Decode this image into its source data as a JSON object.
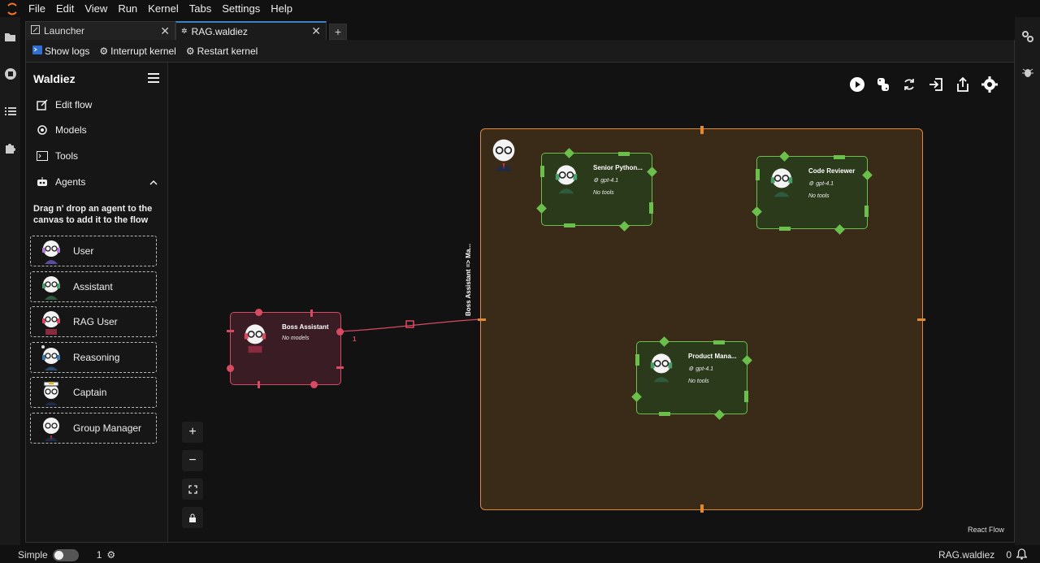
{
  "menu": [
    "File",
    "Edit",
    "View",
    "Run",
    "Kernel",
    "Tabs",
    "Settings",
    "Help"
  ],
  "tabs": [
    {
      "label": "Launcher"
    },
    {
      "label": "RAG.waldiez"
    }
  ],
  "toolbar": {
    "show_logs": "Show logs",
    "interrupt": "Interrupt kernel",
    "restart": "Restart kernel"
  },
  "sidebar": {
    "title": "Waldiez",
    "items": [
      {
        "label": "Edit flow",
        "icon": "edit-icon"
      },
      {
        "label": "Models",
        "icon": "models-icon"
      },
      {
        "label": "Tools",
        "icon": "terminal-icon"
      },
      {
        "label": "Agents",
        "icon": "robot-icon"
      }
    ],
    "hint": "Drag n' drop an agent to the canvas to add it to the flow",
    "agents": [
      "User",
      "Assistant",
      "RAG User",
      "Reasoning",
      "Captain",
      "Group Manager"
    ]
  },
  "canvas": {
    "group_label": "Boss Assistant => Ma...",
    "edge_label": "1",
    "nodes": [
      {
        "title": "Boss Assistant",
        "model": "",
        "tools": "No models"
      },
      {
        "title": "Senior Python...",
        "model": "gpt-4.1",
        "tools": "No tools"
      },
      {
        "title": "Code Reviewer",
        "model": "gpt-4.1",
        "tools": "No tools"
      },
      {
        "title": "Product Mana...",
        "model": "gpt-4.1",
        "tools": "No tools"
      }
    ],
    "attribution": "React Flow"
  },
  "status": {
    "mode": "Simple",
    "kernels": "1",
    "file": "RAG.waldiez",
    "notifications": "0"
  },
  "colors": {
    "group": "#e48a2e",
    "agent_green": "#6bbf4b",
    "agent_red": "#d84a62",
    "accent": "#3b82c4"
  }
}
